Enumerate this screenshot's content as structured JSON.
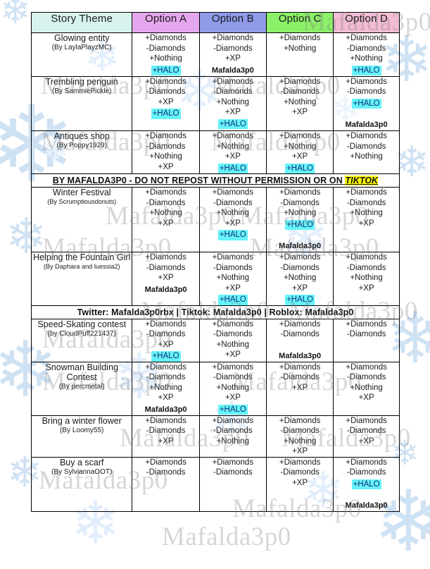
{
  "table": {
    "columns": [
      {
        "label": "Story Theme",
        "color": "#d8f3ef"
      },
      {
        "label": "Option A",
        "color": "#e4a7ed"
      },
      {
        "label": "Option B",
        "color": "#8f9ae8"
      },
      {
        "label": "Option C",
        "color": "#8cf069"
      },
      {
        "label": "Option D",
        "color": "#f2bcd4"
      }
    ],
    "highlight_color": "#66f4f9",
    "banner_border_color": "#c01fd0",
    "tiktok_highlight_color": "#ffff00",
    "rows": [
      {
        "theme": "Glowing entity",
        "author": "(By LaylaPlayzMC)",
        "options": [
          {
            "lines": [
              "+Diamonds",
              "-Diamonds",
              "+Nothing"
            ],
            "halo": "+HALO",
            "watermark": ""
          },
          {
            "lines": [
              "+Diamonds",
              "-Diamonds",
              "+XP"
            ],
            "halo": "",
            "watermark": "Mafalda3p0"
          },
          {
            "lines": [
              "+Diamonds",
              "+Nothing"
            ],
            "halo": "",
            "watermark": ""
          },
          {
            "lines": [
              "+Diamonds",
              "-Diamonds",
              "+Nothing"
            ],
            "halo": "+HALO",
            "watermark": ""
          }
        ]
      },
      {
        "theme": "Trembling penguin",
        "author": "(By SammiePickle)",
        "options": [
          {
            "lines": [
              "+Diamonds",
              "-Diamonds",
              "+XP"
            ],
            "halo": "+HALO",
            "watermark": ""
          },
          {
            "lines": [
              "+Diamonds",
              "-Diamonds",
              "+Nothing",
              "+XP"
            ],
            "halo": "+HALO",
            "watermark": ""
          },
          {
            "lines": [
              "+Diamonds",
              "-Diamonds",
              "+Nothing",
              "+XP"
            ],
            "halo": "",
            "watermark": ""
          },
          {
            "lines": [
              "+Diamonds",
              "-Diamonds"
            ],
            "halo": "+HALO",
            "watermark": "Mafalda3p0"
          }
        ]
      },
      {
        "theme": "Antiques shop",
        "author": "(By Poppy1929)",
        "options": [
          {
            "lines": [
              "+Diamonds",
              "-Diamonds",
              "+Nothing",
              "+XP"
            ],
            "halo": "",
            "watermark": ""
          },
          {
            "lines": [
              "+Diamonds",
              "+Nothing",
              "+XP"
            ],
            "halo": "+HALO",
            "watermark": ""
          },
          {
            "lines": [
              "+Diamonds",
              "+Nothing",
              "+XP"
            ],
            "halo": "+HALO",
            "watermark": ""
          },
          {
            "lines": [
              "+Diamonds",
              "-Diamonds",
              "+Nothing"
            ],
            "halo": "",
            "watermark": ""
          }
        ]
      },
      {
        "theme": "Winter Festival",
        "author": "(By Scrumptiousdonuts)",
        "options": [
          {
            "lines": [
              "+Diamonds",
              "-Diamonds",
              "+Nothing",
              "+XP"
            ],
            "halo": "",
            "watermark": ""
          },
          {
            "lines": [
              "+Diamonds",
              "-Diamonds",
              "+Nothing",
              "+XP"
            ],
            "halo": "+HALO",
            "watermark": ""
          },
          {
            "lines": [
              "+Diamonds",
              "-Diamonds",
              "+Nothing"
            ],
            "halo": "+HALO",
            "watermark": "Mafalda3p0"
          },
          {
            "lines": [
              "+Diamonds",
              "-Diamonds",
              "+Nothing",
              "+XP"
            ],
            "halo": "",
            "watermark": ""
          }
        ]
      },
      {
        "theme": "Helping the Fountain Girl",
        "author": "(By Daphara and luessia2)",
        "options": [
          {
            "lines": [
              "+Diamonds",
              "-Diamonds",
              "+XP"
            ],
            "halo": "",
            "watermark": "Mafalda3p0"
          },
          {
            "lines": [
              "+Diamonds",
              "-Diamonds",
              "+Nothing",
              "+XP"
            ],
            "halo": "+HALO",
            "watermark": ""
          },
          {
            "lines": [
              "+Diamonds",
              "-Diamonds",
              "+Nothing",
              "+XP"
            ],
            "halo": "+HALO",
            "watermark": ""
          },
          {
            "lines": [
              "+Diamonds",
              "-Diamonds",
              "+Nothing",
              "+XP"
            ],
            "halo": "",
            "watermark": ""
          }
        ]
      },
      {
        "theme": "Speed-Skating contest",
        "author": "(by CloudPuff221437)",
        "options": [
          {
            "lines": [
              "+Diamonds",
              "-Diamonds",
              "+XP"
            ],
            "halo": "+HALO",
            "watermark": ""
          },
          {
            "lines": [
              "+Diamonds",
              "-Diamonds",
              "+Nothing",
              "+XP"
            ],
            "halo": "",
            "watermark": ""
          },
          {
            "lines": [
              "+Diamonds",
              "-Diamonds"
            ],
            "halo": "",
            "watermark": "Mafalda3p0"
          },
          {
            "lines": [
              "+Diamonds",
              "-Diamonds"
            ],
            "halo": "",
            "watermark": ""
          }
        ]
      },
      {
        "theme": "Snowman Building Contest",
        "author": "(By percmetal)",
        "options": [
          {
            "lines": [
              "+Diamonds",
              "-Diamonds",
              "+Nothing",
              "+XP"
            ],
            "halo": "",
            "watermark": "Mafalda3p0"
          },
          {
            "lines": [
              "+Diamonds",
              "-Diamonds",
              "+Nothing",
              "+XP"
            ],
            "halo": "+HALO",
            "watermark": ""
          },
          {
            "lines": [
              "+Diamonds",
              "-Diamonds",
              "+XP"
            ],
            "halo": "",
            "watermark": ""
          },
          {
            "lines": [
              "+Diamonds",
              "-Diamonds",
              "+Nothing",
              "+XP"
            ],
            "halo": "",
            "watermark": ""
          }
        ]
      },
      {
        "theme": "Bring a winter flower",
        "author": "(By Loomy55)",
        "options": [
          {
            "lines": [
              "+Diamonds",
              "-Diamonds",
              "+XP"
            ],
            "halo": "",
            "watermark": ""
          },
          {
            "lines": [
              "+Diamonds",
              "-Diamonds",
              "+Nothing"
            ],
            "halo": "",
            "watermark": ""
          },
          {
            "lines": [
              "+Diamonds",
              "-Diamonds",
              "+Nothing",
              "+XP"
            ],
            "halo": "",
            "watermark": ""
          },
          {
            "lines": [
              "+Diamonds",
              "-Diamonds",
              "+XP"
            ],
            "halo": "",
            "watermark": ""
          }
        ]
      },
      {
        "theme": "Buy a scarf",
        "author": "(By SylviannaOOT)",
        "options": [
          {
            "lines": [
              "+Diamonds",
              "-Diamonds"
            ],
            "halo": "",
            "watermark": ""
          },
          {
            "lines": [
              "+Diamonds",
              "-Diamonds"
            ],
            "halo": "",
            "watermark": ""
          },
          {
            "lines": [
              "+Diamonds",
              "-Diamonds",
              "+XP"
            ],
            "halo": "",
            "watermark": ""
          },
          {
            "lines": [
              "+Diamonds",
              "-Diamonds"
            ],
            "halo": "+HALO",
            "watermark": "Mafalda3p0"
          }
        ]
      }
    ],
    "banners": [
      {
        "after_row": 2,
        "prefix": "BY MAFALDA3P0 - DO NOT REPOST WITHOUT PERMISSION OR ON ",
        "emphasis": "TIKTOK"
      },
      {
        "after_row": 4,
        "prefix": "Twitter: Mafalda3p0rbx | Tiktok: Mafalda3p0 | Roblox: Mafalda3p0",
        "emphasis": ""
      }
    ]
  },
  "watermark": {
    "big_text": "Mafalda3p0",
    "small_text": "Mafalda3p0"
  }
}
